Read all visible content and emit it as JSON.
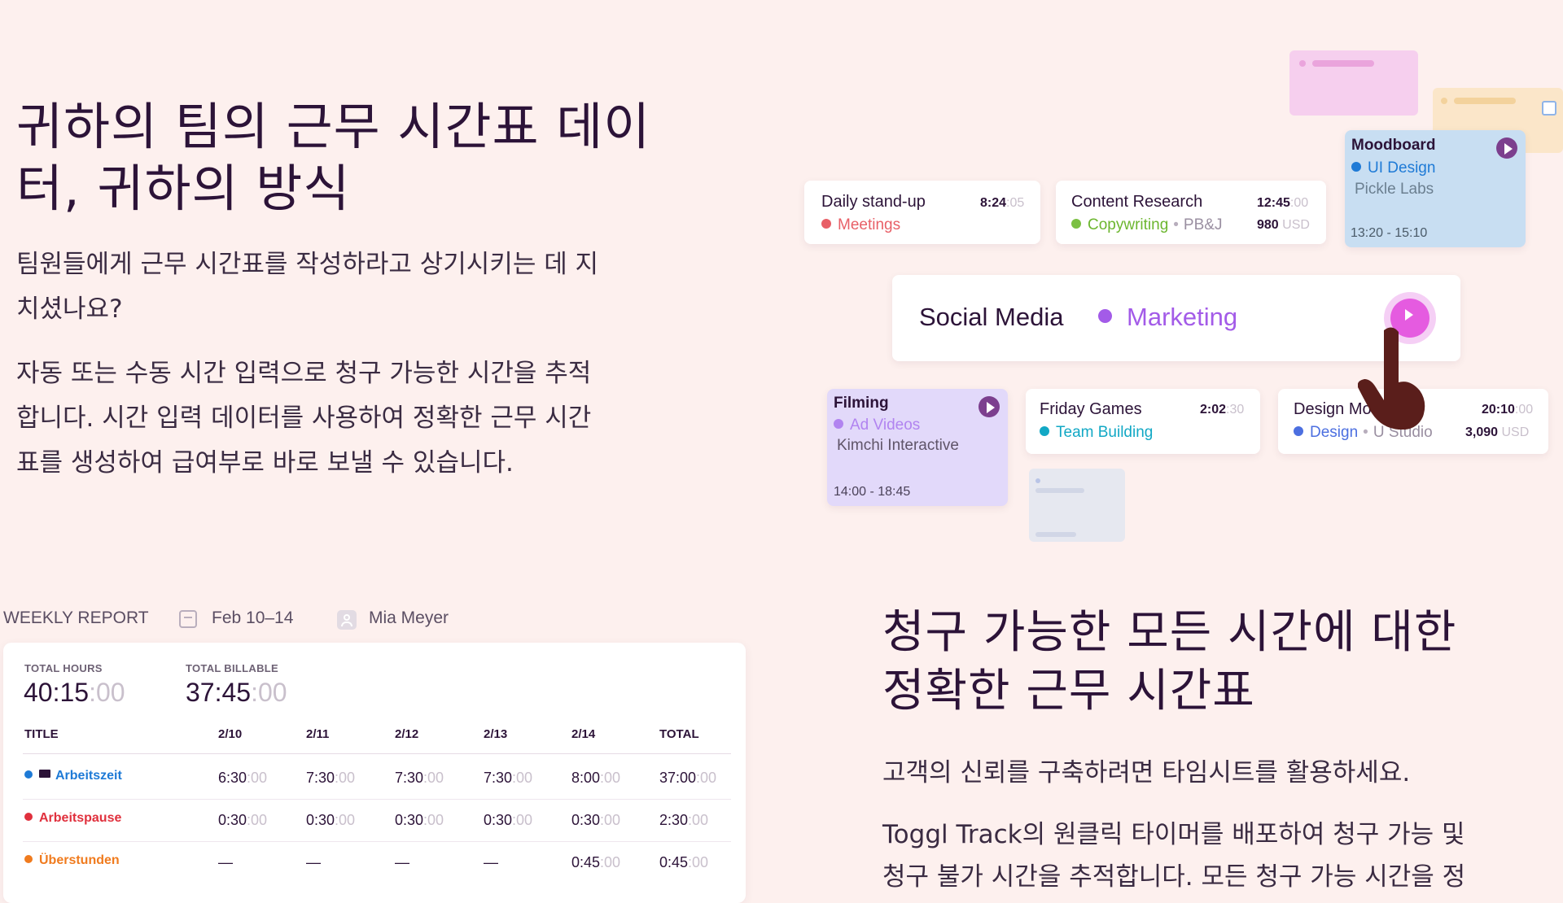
{
  "hero": {
    "title_line1": "귀하의 팀의 근무 시간표 데이",
    "title_line2": "터, 귀하의 방식",
    "para1_line1": "팀원들에게 근무 시간표를 작성하라고 상기시키는 데 지",
    "para1_line2": "치셨나요?",
    "para2_line1": "자동 또는 수동 시간 입력으로 청구 가능한 시간을 추적",
    "para2_line2": "합니다. 시간 입력 데이터를 사용하여 정확한 근무 시간",
    "para2_line3": "표를 생성하여 급여부로 바로 보낼 수 있습니다."
  },
  "entries": {
    "standup": {
      "name": "Daily stand-up",
      "time_main": "8:24",
      "time_dim": ":05",
      "project": "Meetings",
      "color": "#e85f67"
    },
    "research": {
      "name": "Content Research",
      "time_main": "12:45",
      "time_dim": ":00",
      "project": "Copywriting",
      "client": "PB&J",
      "amount": "980",
      "currency": "USD",
      "color": "#7bc043"
    },
    "moodboard": {
      "name": "Moodboard",
      "project": "UI Design",
      "client": "Pickle Labs",
      "range": "13:20 - 15:10",
      "color": "#1e7ad6"
    },
    "social": {
      "name": "Social Media",
      "project": "Marketing",
      "color": "#a35be8"
    },
    "filming": {
      "name": "Filming",
      "project": "Ad Videos",
      "client": "Kimchi Interactive",
      "range": "14:00 - 18:45",
      "color": "#b184f0"
    },
    "games": {
      "name": "Friday Games",
      "time_main": "2:02",
      "time_dim": ":30",
      "project": "Team Building",
      "color": "#12a8c5"
    },
    "mock": {
      "name": "Design Mock",
      "time_main": "20:10",
      "time_dim": ":00",
      "project": "Design",
      "client": "U Studio",
      "amount": "3,090",
      "currency": "USD",
      "color": "#4c6fe0"
    }
  },
  "report": {
    "label": "WEEKLY REPORT",
    "date_range": "Feb 10–14",
    "user": "Mia Meyer",
    "total_hours_label": "TOTAL HOURS",
    "total_hours_main": "40:15",
    "total_hours_dim": ":00",
    "total_billable_label": "TOTAL BILLABLE",
    "total_billable_main": "37:45",
    "total_billable_dim": ":00",
    "columns": [
      "TITLE",
      "2/10",
      "2/11",
      "2/12",
      "2/13",
      "2/14",
      "TOTAL"
    ],
    "rows": [
      {
        "name": "Arbeitszeit",
        "color": "#1e7ad6",
        "cells": [
          [
            "6:30",
            ":00"
          ],
          [
            "7:30",
            ":00"
          ],
          [
            "7:30",
            ":00"
          ],
          [
            "7:30",
            ":00"
          ],
          [
            "8:00",
            ":00"
          ],
          [
            "37:00",
            ":00"
          ]
        ]
      },
      {
        "name": "Arbeitspause",
        "color": "#e0303d",
        "cells": [
          [
            "0:30",
            ":00"
          ],
          [
            "0:30",
            ":00"
          ],
          [
            "0:30",
            ":00"
          ],
          [
            "0:30",
            ":00"
          ],
          [
            "0:30",
            ":00"
          ],
          [
            "2:30",
            ":00"
          ]
        ]
      },
      {
        "name": "Überstunden",
        "color": "#f07b1e",
        "cells": [
          [
            "—",
            ""
          ],
          [
            "—",
            ""
          ],
          [
            "—",
            ""
          ],
          [
            "—",
            ""
          ],
          [
            "0:45",
            ":00"
          ],
          [
            "0:45",
            ":00"
          ]
        ]
      }
    ]
  },
  "section2": {
    "title_line1": "청구 가능한 모든 시간에 대한",
    "title_line2": "정확한 근무 시간표",
    "para1": "고객의 신뢰를 구축하려면 타임시트를 활용하세요.",
    "para2_line1": "Toggl Track의 원클릭 타이머를 배포하여 청구 가능 및",
    "para2_line2": "청구 불가 시간을 추적합니다. 모든 청구 가능 시간을 정"
  }
}
